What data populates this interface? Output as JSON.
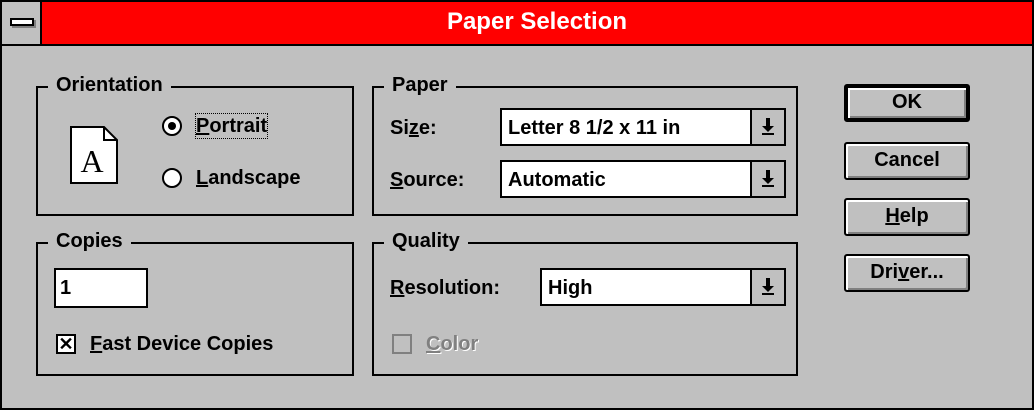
{
  "window": {
    "title": "Paper Selection"
  },
  "orientation": {
    "legend": "Orientation",
    "preview_letter": "A",
    "options": [
      {
        "label": "Portrait",
        "accel": "P",
        "rest": "ortrait",
        "selected": true
      },
      {
        "label": "Landscape",
        "accel": "L",
        "rest": "andscape",
        "selected": false
      }
    ]
  },
  "paper": {
    "legend": "Paper",
    "size": {
      "label_pre": "Si",
      "accel": "z",
      "label_post": "e:",
      "value": "Letter 8 1/2 x 11 in"
    },
    "source": {
      "accel": "S",
      "label_post": "ource:",
      "value": "Automatic"
    }
  },
  "copies": {
    "legend": "Copies",
    "value": "1",
    "fast_copies": {
      "checked_mark": "✕",
      "accel": "F",
      "rest": "ast Device Copies",
      "checked": true
    }
  },
  "quality": {
    "legend": "Quality",
    "resolution": {
      "accel": "R",
      "label_post": "esolution:",
      "value": "High"
    },
    "color": {
      "accel": "C",
      "rest": "olor",
      "checked": false,
      "enabled": false
    }
  },
  "buttons": {
    "ok": "OK",
    "cancel": "Cancel",
    "help_accel": "H",
    "help_rest": "elp",
    "driver_pre": "Dri",
    "driver_accel": "v",
    "driver_post": "er..."
  },
  "icons": {
    "system_menu": "system-menu-icon",
    "dropdown": "dropdown-arrow-icon",
    "page": "portrait-page-icon"
  },
  "colors": {
    "title_bar": "#ff0000",
    "face": "#c0c0c0",
    "title_text": "#ffffff"
  }
}
